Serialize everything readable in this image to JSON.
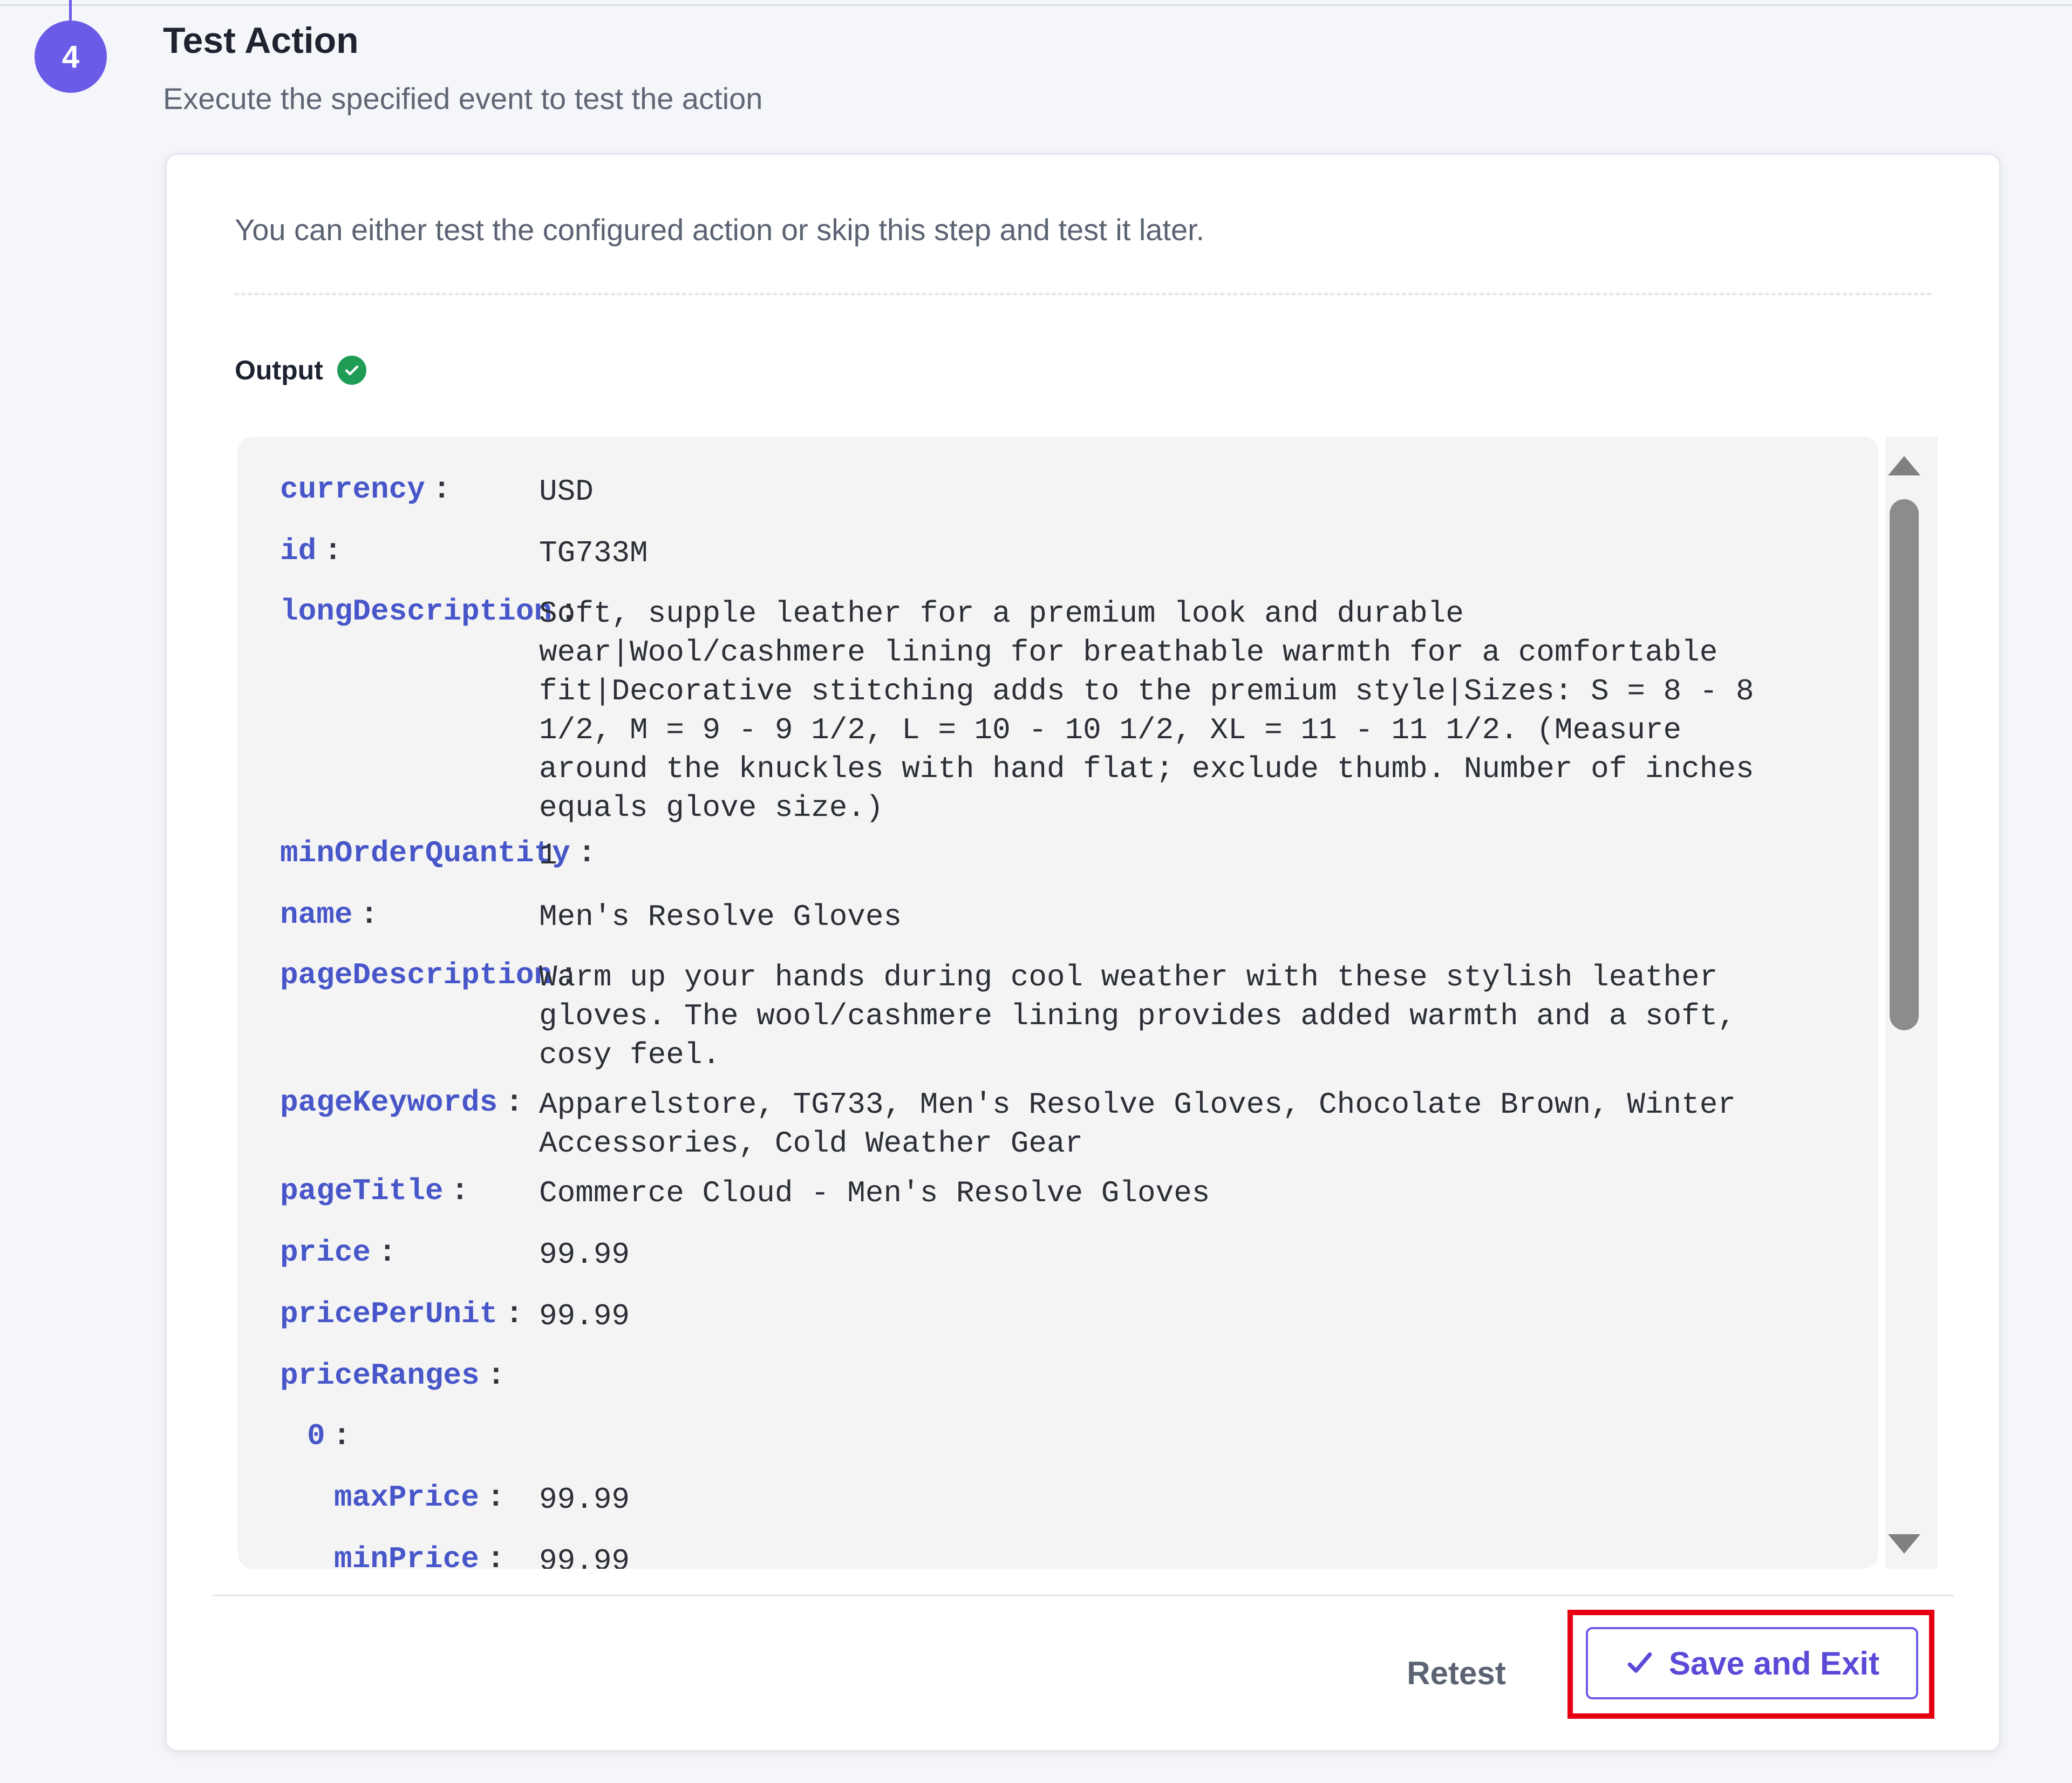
{
  "step": {
    "number": "4",
    "title": "Test Action",
    "subtitle": "Execute the specified event to test the action"
  },
  "card": {
    "intro": "You can either test the configured action or skip this step and test it later.",
    "output_label": "Output",
    "output_status_icon": "check-circle-icon",
    "output_status_color": "#1f9d55"
  },
  "output": {
    "fields": [
      {
        "key": "currency",
        "value": "USD"
      },
      {
        "key": "id",
        "value": "TG733M"
      },
      {
        "key": "longDescription",
        "value": "Soft, supple leather for a premium look and durable\nwear|Wool/cashmere lining for breathable warmth for a comfortable\nfit|Decorative stitching adds to the premium style|Sizes: S = 8 - 8\n1/2, M = 9 - 9 1/2, L = 10 - 10 1/2, XL = 11 - 11 1/2. (Measure\naround the knuckles with hand flat; exclude thumb. Number of inches\nequals glove size.)"
      },
      {
        "key": "minOrderQuantity",
        "value": "1"
      },
      {
        "key": "name",
        "value": "Men's Resolve Gloves"
      },
      {
        "key": "pageDescription",
        "value": "Warm up your hands during cool weather with these stylish leather\ngloves. The wool/cashmere lining provides added warmth and a soft,\ncosy feel."
      },
      {
        "key": "pageKeywords",
        "value": "Apparelstore, TG733, Men's Resolve Gloves, Chocolate Brown, Winter\nAccessories, Cold Weather Gear"
      },
      {
        "key": "pageTitle",
        "value": "Commerce Cloud - Men's Resolve Gloves"
      },
      {
        "key": "price",
        "value": "99.99"
      },
      {
        "key": "pricePerUnit",
        "value": "99.99"
      },
      {
        "key": "priceRanges",
        "value": ""
      },
      {
        "key": "0",
        "value": ""
      },
      {
        "key": "maxPrice",
        "value": "99.99"
      },
      {
        "key": "minPrice",
        "value": "99.99"
      }
    ]
  },
  "actions": {
    "retest_label": "Retest",
    "save_label": "Save and Exit",
    "save_icon": "checkmark-icon"
  },
  "colors": {
    "accent": "#6b5ce7",
    "key_color": "#4756c9",
    "highlight": "#e60012"
  }
}
